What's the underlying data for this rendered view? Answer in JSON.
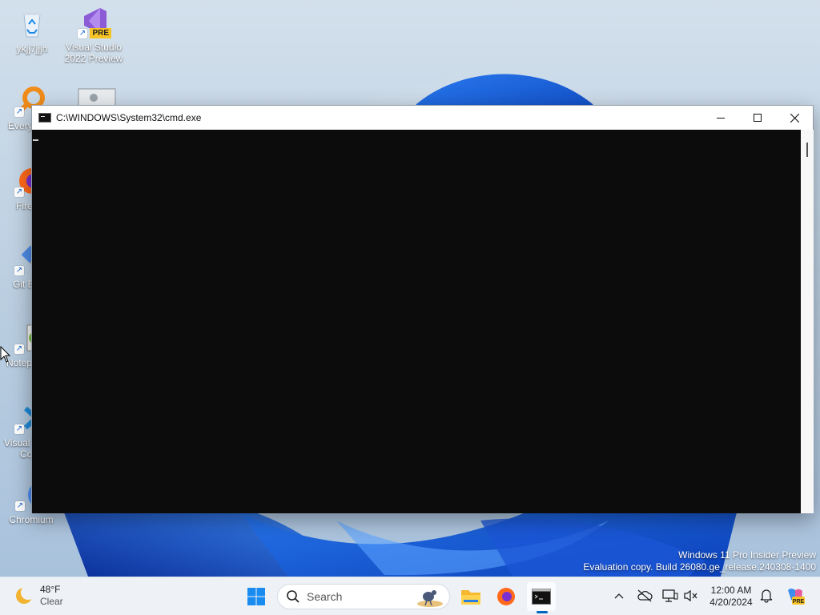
{
  "desktop": {
    "icons": [
      {
        "label": "ykjj7jjjh",
        "icon": "recycle-bin-icon"
      },
      {
        "label": "Visual Studio 2022 Preview",
        "icon": "visual-studio-icon",
        "badge": "PRE"
      },
      {
        "label": "Every",
        "icon": "everything-search-icon"
      },
      {
        "label": "",
        "icon": "settings-window-icon"
      },
      {
        "label": "Fire",
        "icon": "firefox-icon"
      },
      {
        "label": "Git E",
        "icon": "git-extensions-icon"
      },
      {
        "label": "Notep",
        "icon": "notepad-plus-plus-icon"
      },
      {
        "label": "Visual",
        "label2": "Co",
        "icon": "vscode-icon"
      },
      {
        "label": "Chromium",
        "icon": "chromium-icon"
      }
    ]
  },
  "window": {
    "title": "C:\\WINDOWS\\System32\\cmd.exe",
    "console_bg": "#0c0c0c"
  },
  "watermark": {
    "line1": "Windows 11 Pro Insider Preview",
    "line2": "Evaluation copy. Build 26080.ge_release.240308-1400"
  },
  "taskbar": {
    "weather": {
      "temp": "48°F",
      "condition": "Clear"
    },
    "search_placeholder": "Search",
    "pinned": [
      "start-icon",
      "search",
      "file-explorer-icon",
      "firefox-icon",
      "terminal-icon"
    ],
    "clock": {
      "time": "12:00 AM",
      "date": "4/20/2024"
    },
    "accent": "#0067c0"
  }
}
